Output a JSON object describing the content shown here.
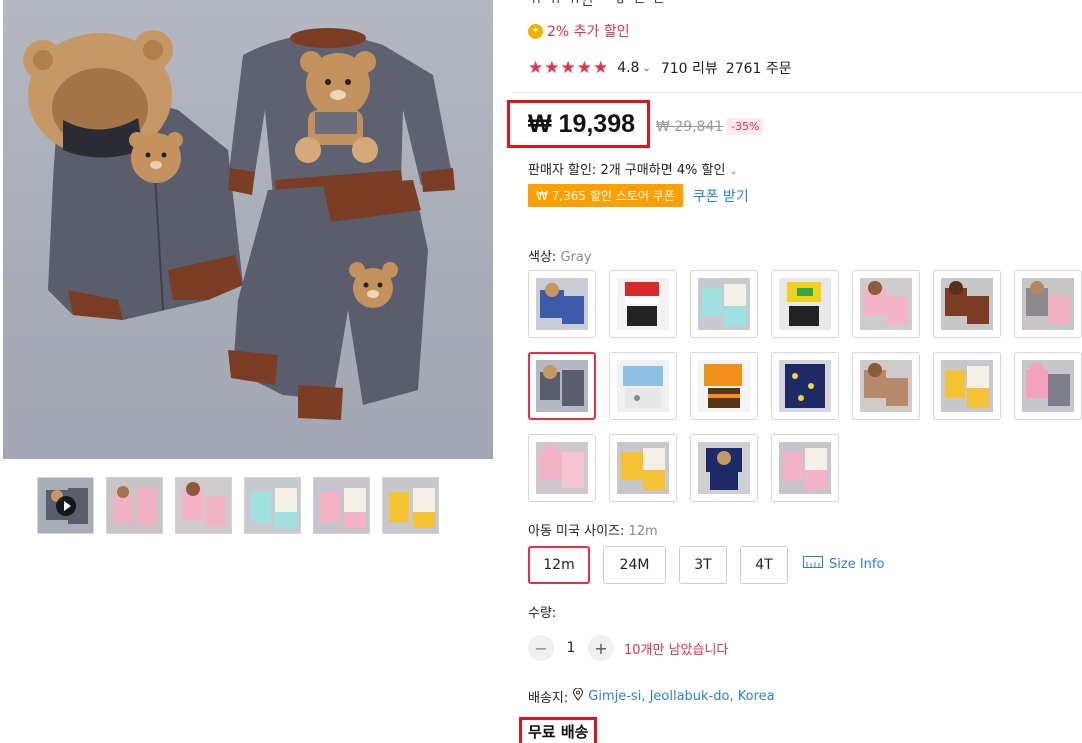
{
  "product": {
    "title_fragment": "ㄲ ㄲ ㄲ인 ㅡㅎ ㄴ ㄴ",
    "extra_discount": "2% 추가 할인",
    "rating": "4.8",
    "reviews": "710 리뷰",
    "orders": "2761 주문",
    "price_now": "₩ 19,398",
    "price_old": "₩ 29,841",
    "discount_pct": "-35%",
    "seller_discount": "판매자 할인: 2개 구매하면 4% 할인",
    "coupon_chip": "₩ 7,365 할인 스토어 쿠폰",
    "coupon_link": "쿠폰 받기"
  },
  "color": {
    "label": "색상: ",
    "selected": "Gray"
  },
  "size": {
    "label": "아동 미국 사이즈: ",
    "selected": "12m",
    "options": [
      "12m",
      "24M",
      "3T",
      "4T"
    ],
    "info_link": "Size Info"
  },
  "quantity": {
    "label": "수량:",
    "value": "1",
    "minus": "−",
    "plus": "+",
    "stock_note": "10개만 남았습니다"
  },
  "shipping": {
    "label": "배송지:",
    "location": "Gimje-si, Jeollabuk-do, Korea",
    "free": "무료 배송"
  },
  "icons": {
    "coin": "coin-icon",
    "pin": "location-pin-icon",
    "ruler": "ruler-icon",
    "play": "play-icon",
    "chevron": "chevron-down-icon"
  },
  "colors": {
    "accent": "#ee2c44",
    "link": "#2d7fd6",
    "coupon": "#ffa000",
    "highlight": "#e0151b"
  }
}
